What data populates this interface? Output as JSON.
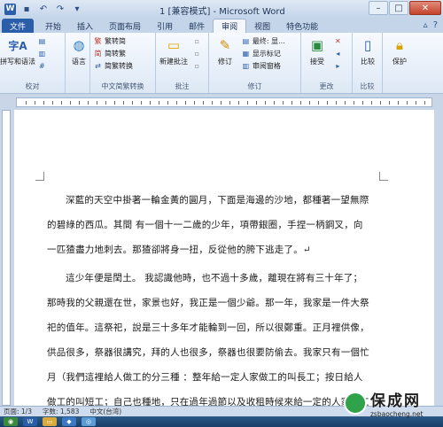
{
  "window": {
    "title": "1 [兼容模式] - Microsoft Word"
  },
  "tabs": [
    {
      "label": "文件"
    },
    {
      "label": "开始"
    },
    {
      "label": "插入"
    },
    {
      "label": "页面布局"
    },
    {
      "label": "引用"
    },
    {
      "label": "邮件"
    },
    {
      "label": "审阅"
    },
    {
      "label": "视图"
    },
    {
      "label": "特色功能"
    }
  ],
  "ribbon": {
    "groups": {
      "proofing": {
        "label": "校对",
        "spelling": "拼写和语法",
        "language": "语言"
      },
      "chinese_conv": {
        "label": "中文简繁转换",
        "to_trad": "繁转简",
        "to_simp": "简转繁",
        "convert": "简繁转换"
      },
      "comments": {
        "label": "批注",
        "new_comment": "新建批注"
      },
      "tracking": {
        "label": "修订",
        "track": "修订",
        "final_show": "最终: 显...",
        "show_markup": "显示标记",
        "review_pane": "审阅窗格"
      },
      "changes": {
        "label": "更改",
        "accept": "接受"
      },
      "compare": {
        "label": "比较",
        "compare": "比较"
      },
      "protect": {
        "label": "保护",
        "protect": "保护"
      }
    }
  },
  "document": {
    "paragraphs": [
      "深藍的天空中掛著一輪金黃的圓月，下面是海邊的沙地，都種著一望無際的碧綠的西瓜。其間 有一個十一二歲的少年，項帶銀圈，手捏一柄鋼叉，向一匹猹盡力地刺去。那猹卻將身一扭，反從他的胯下逃走了。↵",
      "這少年便是閏土。 我認識他時，也不過十多歲，離現在將有三十年了；那時我的父親還在世，家景也好，我正是一個少爺。那一年，我家是一件大祭祀的值年。這祭祀，說是三十多年才能輪到一回，所以很鄭重。正月裡供像，供品很多，祭器很講究，拜的人也很多，祭器也很要防偷去。我家只有一個忙月（我們這裡給人做工的分三種 ：整年給一定人家做工的叫長工；按日給人做工的叫短工；自己也種地，只在過年過節以及收租時候來給一定的人家做工的"
    ]
  },
  "statusbar": {
    "page": "页面: 1/3",
    "words": "字数: 1,583",
    "lang": "中文(台湾)"
  },
  "watermark": {
    "brand": "保成网",
    "url": "zsbaocheng.net"
  },
  "colors": {
    "file_tab": "#2b5ea8",
    "ribbon_bg": "#dde8f5",
    "watermark_green": "#2fa24a"
  }
}
